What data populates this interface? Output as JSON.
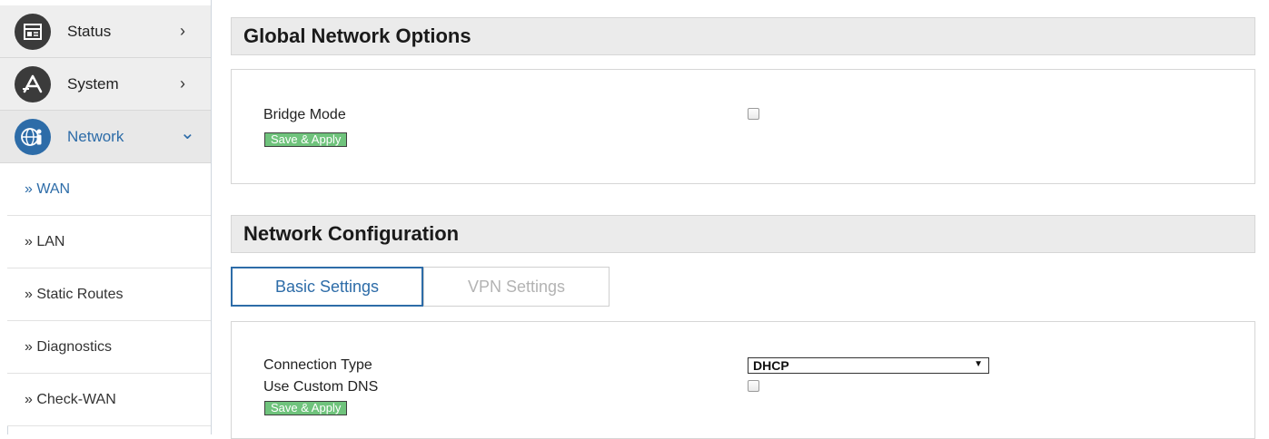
{
  "sidebar": {
    "menu": [
      {
        "label": "Status",
        "icon": "dashboard-icon",
        "arrow": "›"
      },
      {
        "label": "System",
        "icon": "app-store-icon",
        "arrow": "›"
      },
      {
        "label": "Network",
        "icon": "globe-person-icon",
        "arrow": "⌄"
      }
    ],
    "submenu": [
      {
        "label": "» WAN"
      },
      {
        "label": "» LAN"
      },
      {
        "label": "» Static Routes"
      },
      {
        "label": "» Diagnostics"
      },
      {
        "label": "» Check-WAN"
      }
    ]
  },
  "global_options": {
    "title": "Global Network Options",
    "bridge_mode_label": "Bridge Mode",
    "bridge_mode_checked": false,
    "save_label": "Save & Apply"
  },
  "network_config": {
    "title": "Network Configuration",
    "tabs": [
      {
        "label": "Basic Settings",
        "active": true
      },
      {
        "label": "VPN Settings",
        "active": false
      }
    ],
    "connection_type_label": "Connection Type",
    "connection_type_value": "DHCP",
    "custom_dns_label": "Use Custom DNS",
    "custom_dns_checked": false,
    "save_label": "Save & Apply"
  },
  "colors": {
    "accent": "#2d6ca8",
    "save_button": "#6fc37c",
    "header_bg": "#ebebeb"
  }
}
